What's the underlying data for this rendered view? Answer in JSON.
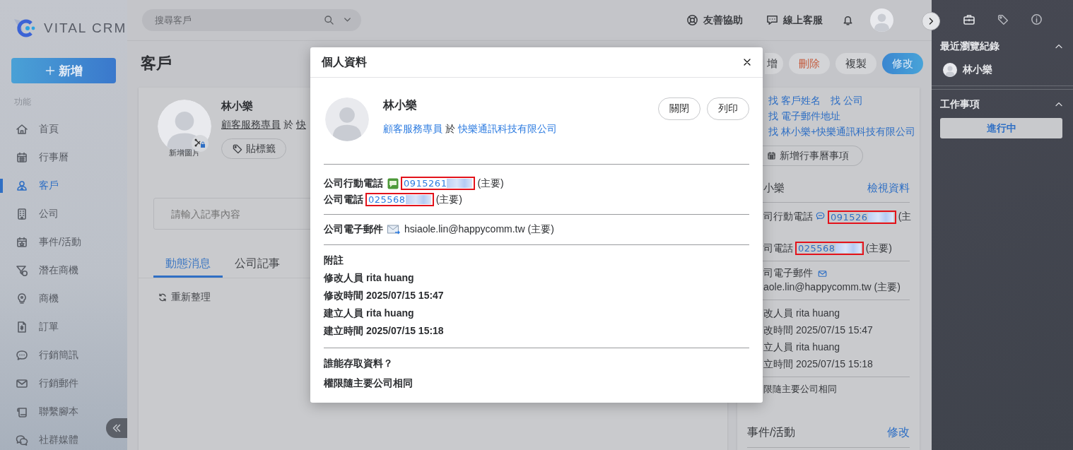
{
  "sidebar": {
    "logo": "VITAL CRM",
    "new_button": "新增",
    "section": "功能",
    "items": [
      {
        "label": "首頁",
        "selected": false
      },
      {
        "label": "行事曆",
        "selected": false
      },
      {
        "label": "客戶",
        "selected": true
      },
      {
        "label": "公司",
        "selected": false
      },
      {
        "label": "事件/活動",
        "selected": false
      },
      {
        "label": "潛在商機",
        "selected": false
      },
      {
        "label": "商機",
        "selected": false
      },
      {
        "label": "訂單",
        "selected": false
      },
      {
        "label": "行銷簡訊",
        "selected": false
      },
      {
        "label": "行銷郵件",
        "selected": false
      },
      {
        "label": "聯繫腳本",
        "selected": false
      },
      {
        "label": "社群媒體",
        "selected": false
      }
    ]
  },
  "topbar": {
    "search": {
      "placeholder": "搜尋客戶"
    },
    "links": [
      "友善協助",
      "線上客服"
    ]
  },
  "page": {
    "title": "客戶",
    "actions": [
      {
        "label": "增",
        "kind": "default"
      },
      {
        "label": "刪除",
        "kind": "danger"
      },
      {
        "label": "複製",
        "kind": "default"
      },
      {
        "label": "修改",
        "kind": "primary"
      }
    ]
  },
  "profile_card": {
    "avatar_caption": "新增圖片",
    "name": "林小樂",
    "job_title": "顧客服務專員",
    "at": "於",
    "company": "快",
    "tag_button": "貼標籤",
    "note": {
      "placeholder": "請輸入記事內容"
    },
    "tabs": [
      {
        "label": "動態消息",
        "selected": true
      },
      {
        "label": "公司記事",
        "selected": false
      }
    ],
    "refresh": "重新整理"
  },
  "side_card": {
    "search_links": [
      [
        "找 客戶姓名",
        "找 公司"
      ],
      [
        "找 電子郵件地址"
      ],
      [
        "找 林小樂+快樂通訊科技有限公司"
      ]
    ],
    "calendar_button": "新增行事曆事項",
    "contact_name": "小樂",
    "view_link": "檢視資料",
    "mobile": {
      "label": "司行動電話",
      "number": "091526",
      "suffix": "(主",
      "highlighted": true
    },
    "phone": {
      "label": "司電話",
      "number": "025568",
      "suffix": "(主要)",
      "highlighted": true
    },
    "email": {
      "label": "司電子郵件",
      "value": "aole.lin@happycomm.tw (主要)"
    },
    "meta": [
      "改人員 rita huang",
      "改時間 2025/07/15 15:47",
      "立人員 rita huang",
      "立時間 2025/07/15 15:18"
    ],
    "access": "限隨主要公司相同",
    "section": {
      "title": "事件/活動",
      "action": "修改"
    }
  },
  "right_panel": {
    "recent": {
      "title": "最近瀏覽紀錄",
      "expanded": true,
      "items": [
        "林小樂"
      ]
    },
    "tasks": {
      "title": "工作事項",
      "expanded": true,
      "button": "進行中"
    }
  },
  "modal": {
    "title": "個人資料",
    "name": "林小樂",
    "job_title": "顧客服務專員",
    "at": "於",
    "company": "快樂通訊科技有限公司",
    "buttons": [
      "關閉",
      "列印"
    ],
    "mobile": {
      "label": "公司行動電話",
      "number": "0915261",
      "suffix": "(主要)",
      "highlighted": true
    },
    "phone": {
      "label": "公司電話",
      "number": "025568",
      "suffix": "(主要)",
      "highlighted": true
    },
    "email": {
      "label": "公司電子郵件",
      "value": "hsiaole.lin@happycomm.tw (主要)"
    },
    "notes_title": "附註",
    "meta": [
      "修改人員 rita huang",
      "修改時間 2025/07/15 15:47",
      "建立人員 rita huang",
      "建立時間 2025/07/15 15:18"
    ],
    "access_title": "誰能存取資料？",
    "access": "權限隨主要公司相同"
  }
}
